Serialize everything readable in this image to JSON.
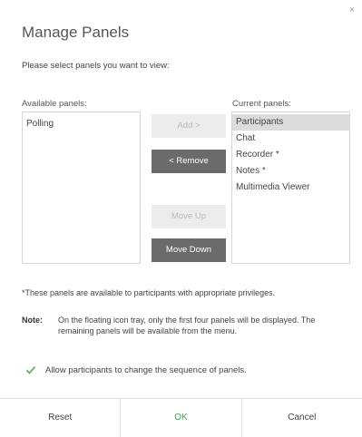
{
  "dialog": {
    "title": "Manage Panels",
    "close_glyph": "×",
    "instruction": "Please select panels you want to view:"
  },
  "available": {
    "label": "Available panels:",
    "items": [
      "Polling"
    ]
  },
  "current": {
    "label": "Current panels:",
    "items": [
      "Participants",
      "Chat",
      "Recorder *",
      "Notes *",
      "Multimedia Viewer"
    ],
    "selected_index": 0
  },
  "buttons": {
    "add": "Add >",
    "remove": "< Remove",
    "move_up": "Move Up",
    "move_down": "Move Down"
  },
  "privilege_note": "*These panels are available to participants with appropriate privileges.",
  "note": {
    "label": "Note:",
    "text": "On the floating icon tray, only the first four panels will be displayed. The remaining panels will be available from the menu."
  },
  "checkbox": {
    "label": "Allow participants to change the sequence of panels.",
    "checked": true,
    "check_color": "#4caf50"
  },
  "footer": {
    "reset": "Reset",
    "ok": "OK",
    "cancel": "Cancel"
  },
  "colors": {
    "ok_text": "#3aa34a",
    "dark_button": "#6b6b6b",
    "selected_row": "#dcdcdc"
  }
}
